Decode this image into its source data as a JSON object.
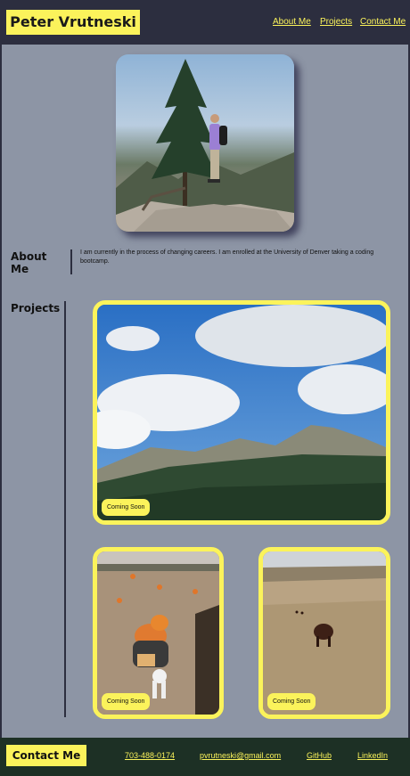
{
  "header": {
    "brand": "Peter Vrutneski",
    "nav": [
      "About Me",
      "Projects",
      "Contact Me"
    ]
  },
  "about": {
    "title": "About Me",
    "text": "I am currently in the process of changing careers. I am enrolled at the University of Denver taking a coding bootcamp."
  },
  "projects": {
    "title": "Projects",
    "cards": [
      {
        "badge": "Coming Soon"
      },
      {
        "badge": "Coming Soon"
      },
      {
        "badge": "Coming Soon"
      }
    ]
  },
  "footer": {
    "title": "Contact Me",
    "links": [
      "703-488-0174",
      "pvrutneski@gmail.com",
      "GitHub",
      "LinkedIn"
    ]
  },
  "colors": {
    "accent": "#fbf35b",
    "header_bg": "#2c2e3f",
    "page_bg": "#8d95a5",
    "footer_bg": "#1d3025"
  }
}
